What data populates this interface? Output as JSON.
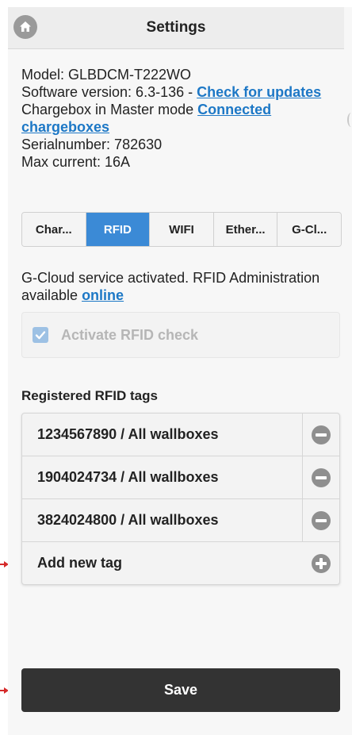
{
  "header": {
    "title": "Settings",
    "home_icon": "home-icon"
  },
  "info": {
    "model_line": "Model: GLBDCM-T222WO",
    "software_prefix": "Software version: 6.3-136 - ",
    "check_updates_link": "Check for updates",
    "chargebox_prefix": "Chargebox in Master mode ",
    "connected_link": "Connected chargeboxes",
    "serial_line": "Serialnumber: 782630",
    "max_current_line": "Max current: 16A"
  },
  "tabs": [
    {
      "label": "Char..."
    },
    {
      "label": "RFID",
      "active": true
    },
    {
      "label": "WIFI"
    },
    {
      "label": "Ether..."
    },
    {
      "label": "G-Cl..."
    }
  ],
  "rfid": {
    "gcloud_text": "G-Cloud service activated. RFID Administration available ",
    "online_link": "online",
    "activate_check_label": "Activate RFID check",
    "activate_check_checked": true,
    "activate_check_disabled": true,
    "registered_title": "Registered RFID tags",
    "tags": [
      {
        "label": "1234567890 / All wallboxes",
        "action_icon": "minus-circle-icon"
      },
      {
        "label": "1904024734 / All wallboxes",
        "action_icon": "minus-circle-icon"
      },
      {
        "label": "3824024800 / All wallboxes",
        "action_icon": "minus-circle-icon"
      }
    ],
    "add_new_label": "Add new tag",
    "add_icon": "plus-circle-icon"
  },
  "save_label": "Save",
  "colors": {
    "accent": "#3b8ad6",
    "link": "#1d78c6",
    "save_bg": "#333333",
    "annotation_arrow": "#d52a2a"
  }
}
